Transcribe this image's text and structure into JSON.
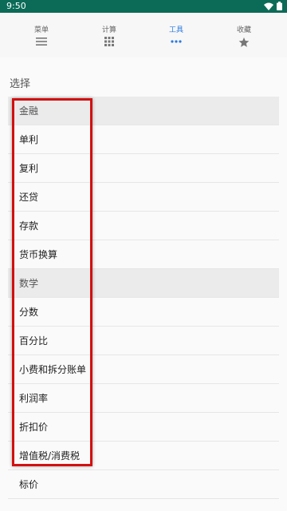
{
  "status": {
    "time": "9:50"
  },
  "tabs": [
    {
      "label": "菜单",
      "icon": "menu-icon"
    },
    {
      "label": "计算",
      "icon": "calculator-grid-icon"
    },
    {
      "label": "工具",
      "icon": "more-dots-icon"
    },
    {
      "label": "收藏",
      "icon": "star-icon"
    }
  ],
  "active_tab": "工具",
  "section_title": "选择",
  "list": [
    {
      "label": "金融",
      "type": "group"
    },
    {
      "label": "单利",
      "type": "item"
    },
    {
      "label": "复利",
      "type": "item"
    },
    {
      "label": "还贷",
      "type": "item"
    },
    {
      "label": "存款",
      "type": "item"
    },
    {
      "label": "货币换算",
      "type": "item"
    },
    {
      "label": "数学",
      "type": "group"
    },
    {
      "label": "分数",
      "type": "item"
    },
    {
      "label": "百分比",
      "type": "item"
    },
    {
      "label": "小费和拆分账单",
      "type": "item"
    },
    {
      "label": "利润率",
      "type": "item"
    },
    {
      "label": "折扣价",
      "type": "item"
    },
    {
      "label": "增值税/消费税",
      "type": "item"
    },
    {
      "label": "标价",
      "type": "item"
    }
  ],
  "colors": {
    "status_bar": "#0b6b57",
    "accent": "#2a7ae2",
    "highlight_box": "#d21010"
  }
}
